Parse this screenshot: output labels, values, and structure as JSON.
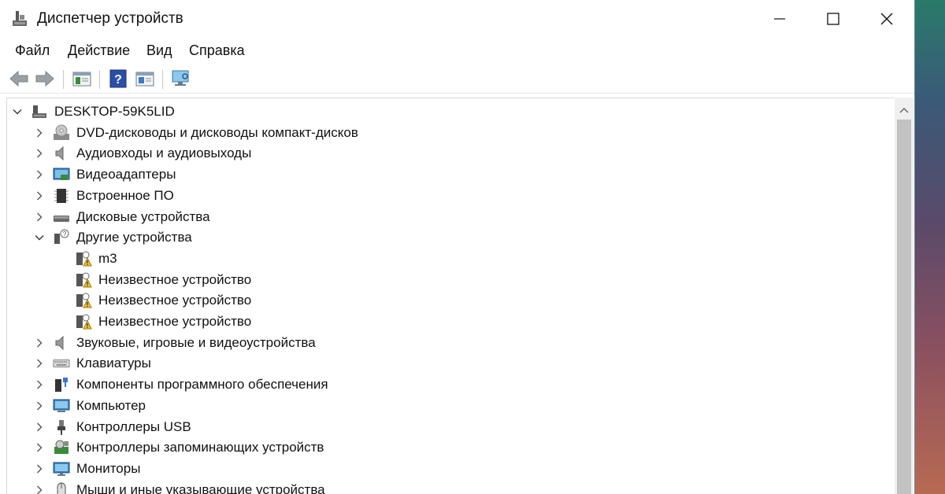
{
  "window": {
    "title": "Диспетчер устройств"
  },
  "menu": [
    "Файл",
    "Действие",
    "Вид",
    "Справка"
  ],
  "toolbar": [
    "back-icon",
    "forward-icon",
    "properties-panel-icon",
    "help-icon",
    "device-view-icon",
    "monitor-scan-icon"
  ],
  "tree": {
    "root": "DESKTOP-59K5LID",
    "items": [
      {
        "label": "DVD-дисководы и дисководы компакт-дисков",
        "icon": "dvd-drive-icon",
        "expanded": false
      },
      {
        "label": "Аудиовходы и аудиовыходы",
        "icon": "speaker-icon",
        "expanded": false
      },
      {
        "label": "Видеоадаптеры",
        "icon": "display-adapter-icon",
        "expanded": false
      },
      {
        "label": "Встроенное ПО",
        "icon": "firmware-chip-icon",
        "expanded": false
      },
      {
        "label": "Дисковые устройства",
        "icon": "disk-drive-icon",
        "expanded": false
      },
      {
        "label": "Другие устройства",
        "icon": "other-devices-icon",
        "expanded": true,
        "children": [
          {
            "label": "m3",
            "icon": "unknown-device-warning-icon"
          },
          {
            "label": "Неизвестное устройство",
            "icon": "unknown-device-warning-icon"
          },
          {
            "label": "Неизвестное устройство",
            "icon": "unknown-device-warning-icon"
          },
          {
            "label": "Неизвестное устройство",
            "icon": "unknown-device-warning-icon"
          }
        ]
      },
      {
        "label": "Звуковые, игровые и видеоустройства",
        "icon": "sound-icon",
        "expanded": false
      },
      {
        "label": "Клавиатуры",
        "icon": "keyboard-icon",
        "expanded": false
      },
      {
        "label": "Компоненты программного обеспечения",
        "icon": "software-component-icon",
        "expanded": false
      },
      {
        "label": "Компьютер",
        "icon": "computer-icon",
        "expanded": false
      },
      {
        "label": "Контроллеры USB",
        "icon": "usb-icon",
        "expanded": false
      },
      {
        "label": "Контроллеры запоминающих устройств",
        "icon": "storage-controller-icon",
        "expanded": false
      },
      {
        "label": "Мониторы",
        "icon": "monitor-icon",
        "expanded": false
      },
      {
        "label": "Мыши и иные указывающие устройства",
        "icon": "mouse-icon",
        "expanded": false
      }
    ]
  }
}
